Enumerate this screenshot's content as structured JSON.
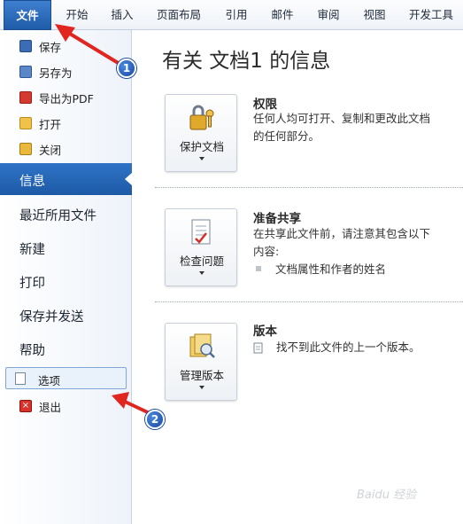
{
  "ribbon": {
    "tabs": [
      "文件",
      "开始",
      "插入",
      "页面布局",
      "引用",
      "邮件",
      "审阅",
      "视图",
      "开发工具"
    ]
  },
  "nav": {
    "small_items": [
      {
        "label": "保存",
        "icon": "save-icon"
      },
      {
        "label": "另存为",
        "icon": "save-as-icon"
      },
      {
        "label": "导出为PDF",
        "icon": "pdf-icon"
      },
      {
        "label": "打开",
        "icon": "open-folder-icon"
      },
      {
        "label": "关闭",
        "icon": "close-folder-icon"
      }
    ],
    "selected": "信息",
    "big_items": [
      "最近所用文件",
      "新建",
      "打印",
      "保存并发送",
      "帮助"
    ],
    "options_label": "选项",
    "exit_label": "退出"
  },
  "main": {
    "title": "有关 文档1 的信息",
    "sections": [
      {
        "button_label": "保护文档",
        "icon": "lock-key-icon",
        "heading": "权限",
        "text": "任何人均可打开、复制和更改此文档的任何部分。"
      },
      {
        "button_label": "检查问题",
        "icon": "inspect-document-icon",
        "heading": "准备共享",
        "text": "在共享此文件前，请注意其包含以下内容:",
        "bullet": "文档属性和作者的姓名"
      },
      {
        "button_label": "管理版本",
        "icon": "manage-versions-icon",
        "heading": "版本",
        "text": "找不到此文件的上一个版本。"
      }
    ]
  },
  "annotations": {
    "badge1": "1",
    "badge2": "2",
    "color": "#e0261f"
  },
  "watermark": "Baidu 经验"
}
